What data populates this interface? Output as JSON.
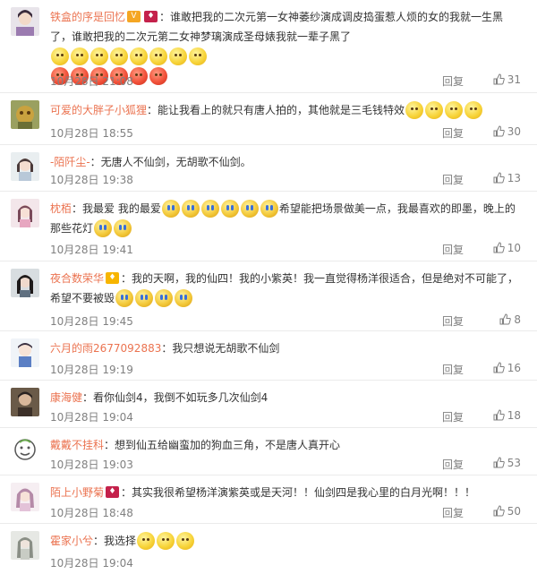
{
  "reply_label": "回复",
  "comments": [
    {
      "user": "铁盒的序是回忆",
      "badge": "vip",
      "text_parts": [
        "：谁敢把我的二次元第一女神萎纱演成调皮捣蛋惹人烦的女的我就一生黑了，谁敢把我的二次元第二女神梦璃演成圣母婊我就一辈子黑了"
      ],
      "emoji": [
        {
          "kind": "smile",
          "count": 8
        },
        {
          "kind": "angry",
          "count": 6
        }
      ],
      "time": "10月28日 21:08",
      "likes": "31"
    },
    {
      "user": "可爱的大胖子小狐狸",
      "text_parts": [
        "：能让我看上的就只有唐人拍的，其他就是三毛钱特效"
      ],
      "emoji": [
        {
          "kind": "smile",
          "count": 4
        }
      ],
      "time": "10月28日 18:55",
      "likes": "30"
    },
    {
      "user": "-陌阡尘-",
      "text_parts": [
        "：无唐人不仙剑，无胡歌不仙剑。"
      ],
      "time": "10月28日 19:38",
      "likes": "13"
    },
    {
      "user": "枕栢",
      "text_parts": [
        "：我最爱 我的最爱",
        "希望能把场景做美一点，我最喜欢的即墨，晚上的那些花灯"
      ],
      "emoji": [
        {
          "kind": "cry",
          "count": 6
        },
        {
          "kind": "cry",
          "count": 2
        }
      ],
      "time": "10月28日 19:41",
      "likes": "10"
    },
    {
      "user": "夜合数荣华",
      "badge": "vip",
      "text_parts": [
        "：我的天啊，我的仙四！我的小紫英！我一直觉得杨洋很适合，但是绝对不可能了，希望不要被毁"
      ],
      "emoji": [
        {
          "kind": "cry",
          "count": 4
        }
      ],
      "time": "10月28日 19:45",
      "likes": "8"
    },
    {
      "user": "六月的雨2677092883",
      "text_parts": [
        "：我只想说无胡歌不仙剑"
      ],
      "time": "10月28日 19:19",
      "likes": "16"
    },
    {
      "user": "康海健",
      "text_parts": [
        "：看你仙剑4，我倒不如玩多几次仙剑4"
      ],
      "time": "10月28日 19:04",
      "likes": "18"
    },
    {
      "user": "戴戴不挂科",
      "text_parts": [
        "：想到仙五给幽蛮加的狗血三角，不是唐人真开心"
      ],
      "time": "10月28日 19:03",
      "likes": "53"
    },
    {
      "user": "陌上小野菊",
      "badge": "vip",
      "text_parts": [
        "：其实我很希望杨洋演紫英或是天河！！仙剑四是我心里的白月光啊！！！"
      ],
      "time": "10月28日 18:48",
      "likes": "50"
    },
    {
      "user": "霍家小兮",
      "text_parts": [
        "：我选择"
      ],
      "emoji": [
        {
          "kind": "smile",
          "count": 3
        }
      ],
      "time": "10月28日 19:04",
      "likes": ""
    }
  ],
  "colors": {
    "username": "#eb7350",
    "meta": "#808080",
    "divider": "#ebebeb"
  }
}
